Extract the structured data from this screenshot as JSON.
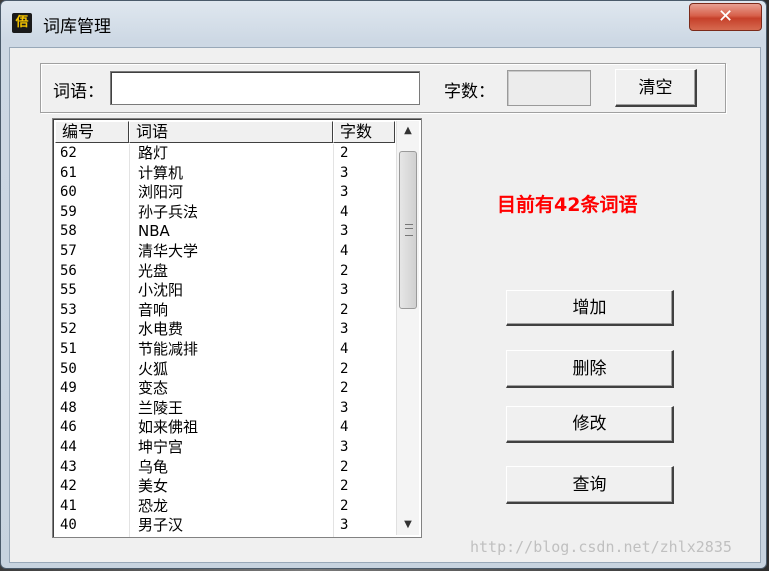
{
  "window": {
    "title": "词库管理",
    "icon_text": "俉",
    "close_label": "✕"
  },
  "form": {
    "word_label": "词语：",
    "word_value": "",
    "count_label": "字数：",
    "count_value": "",
    "clear_button": "清空"
  },
  "list": {
    "headers": [
      "编号",
      "词语",
      "字数"
    ],
    "rows": [
      [
        "62",
        "路灯",
        "2"
      ],
      [
        "61",
        "计算机",
        "3"
      ],
      [
        "60",
        "浏阳河",
        "3"
      ],
      [
        "59",
        "孙子兵法",
        "4"
      ],
      [
        "58",
        "NBA",
        "3"
      ],
      [
        "57",
        "清华大学",
        "4"
      ],
      [
        "56",
        "光盘",
        "2"
      ],
      [
        "55",
        "小沈阳",
        "3"
      ],
      [
        "53",
        "音响",
        "2"
      ],
      [
        "52",
        "水电费",
        "3"
      ],
      [
        "51",
        "节能减排",
        "4"
      ],
      [
        "50",
        "火狐",
        "2"
      ],
      [
        "49",
        "变态",
        "2"
      ],
      [
        "48",
        "兰陵王",
        "3"
      ],
      [
        "46",
        "如来佛祖",
        "4"
      ],
      [
        "44",
        "坤宁宫",
        "3"
      ],
      [
        "43",
        "乌龟",
        "2"
      ],
      [
        "42",
        "美女",
        "2"
      ],
      [
        "41",
        "恐龙",
        "2"
      ],
      [
        "40",
        "男子汉",
        "3"
      ]
    ]
  },
  "status": {
    "text": "目前有42条词语",
    "color": "#ff0000"
  },
  "actions": {
    "add": "增加",
    "delete": "删除",
    "modify": "修改",
    "query": "查询"
  },
  "watermark": "http://blog.csdn.net/zhlx2835",
  "icons": {
    "scroll_up": "scroll-up-arrow-icon",
    "scroll_down": "scroll-down-arrow-icon",
    "app": "app-icon",
    "close": "close-icon"
  }
}
